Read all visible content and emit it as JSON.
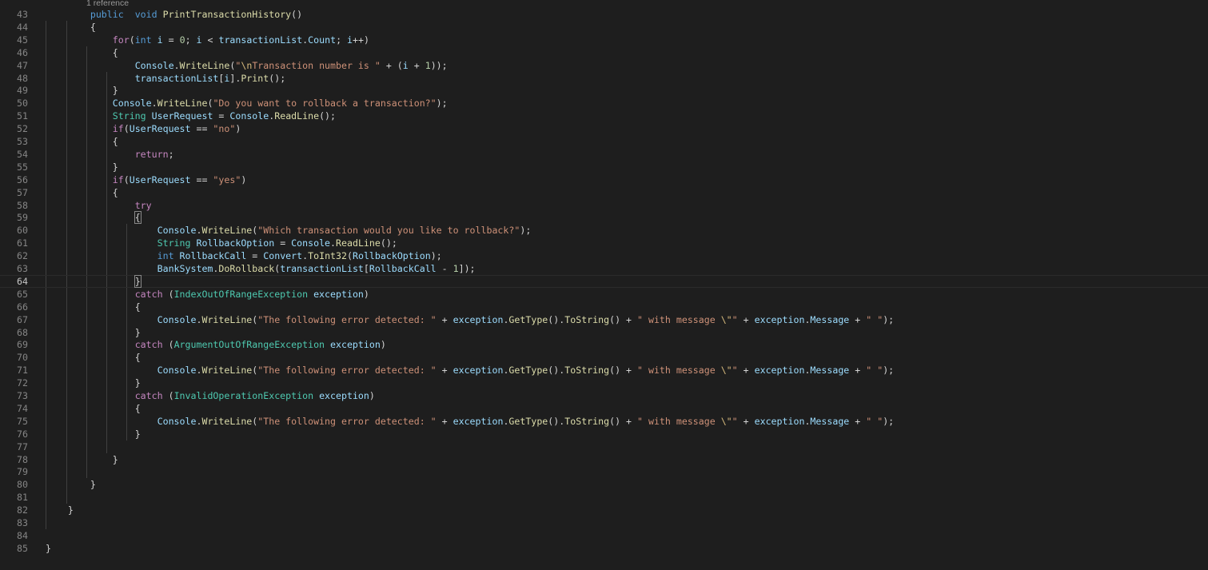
{
  "codelens": "1 reference",
  "lines": [
    {
      "n": "43",
      "indent": "        ",
      "tokens": [
        [
          "kw",
          "public"
        ],
        [
          "",
          "  "
        ],
        [
          "kw",
          "void"
        ],
        [
          "",
          " "
        ],
        [
          "fn",
          "PrintTransactionHistory"
        ],
        [
          "",
          "()"
        ]
      ]
    },
    {
      "n": "44",
      "indent": "        ",
      "tokens": [
        [
          "",
          "{"
        ]
      ]
    },
    {
      "n": "45",
      "indent": "            ",
      "tokens": [
        [
          "ctl",
          "for"
        ],
        [
          "",
          "("
        ],
        [
          "kw",
          "int"
        ],
        [
          "",
          " "
        ],
        [
          "var",
          "i"
        ],
        [
          "",
          " = "
        ],
        [
          "num",
          "0"
        ],
        [
          "",
          "; "
        ],
        [
          "var",
          "i"
        ],
        [
          "",
          " < "
        ],
        [
          "var",
          "transactionList"
        ],
        [
          "",
          "."
        ],
        [
          "var",
          "Count"
        ],
        [
          "",
          "; "
        ],
        [
          "var",
          "i"
        ],
        [
          "",
          "++)"
        ]
      ]
    },
    {
      "n": "46",
      "indent": "            ",
      "tokens": [
        [
          "",
          "{"
        ]
      ]
    },
    {
      "n": "47",
      "indent": "                ",
      "tokens": [
        [
          "var",
          "Console"
        ],
        [
          "",
          "."
        ],
        [
          "fn",
          "WriteLine"
        ],
        [
          "",
          "("
        ],
        [
          "str",
          "\""
        ],
        [
          "esc",
          "\\n"
        ],
        [
          "str",
          "Transaction number is \""
        ],
        [
          "",
          " + ("
        ],
        [
          "var",
          "i"
        ],
        [
          "",
          " + "
        ],
        [
          "num",
          "1"
        ],
        [
          "",
          "));"
        ]
      ]
    },
    {
      "n": "48",
      "indent": "                ",
      "tokens": [
        [
          "var",
          "transactionList"
        ],
        [
          "",
          "["
        ],
        [
          "var",
          "i"
        ],
        [
          "",
          "]."
        ],
        [
          "fn",
          "Print"
        ],
        [
          "",
          "();"
        ]
      ]
    },
    {
      "n": "49",
      "indent": "            ",
      "tokens": [
        [
          "",
          "}"
        ]
      ]
    },
    {
      "n": "50",
      "indent": "            ",
      "tokens": [
        [
          "var",
          "Console"
        ],
        [
          "",
          "."
        ],
        [
          "fn",
          "WriteLine"
        ],
        [
          "",
          "("
        ],
        [
          "str",
          "\"Do you want to rollback a transaction?\""
        ],
        [
          "",
          ");"
        ]
      ]
    },
    {
      "n": "51",
      "indent": "            ",
      "tokens": [
        [
          "ty",
          "String"
        ],
        [
          "",
          " "
        ],
        [
          "var",
          "UserRequest"
        ],
        [
          "",
          " = "
        ],
        [
          "var",
          "Console"
        ],
        [
          "",
          "."
        ],
        [
          "fn",
          "ReadLine"
        ],
        [
          "",
          "();"
        ]
      ]
    },
    {
      "n": "52",
      "indent": "            ",
      "tokens": [
        [
          "ctl",
          "if"
        ],
        [
          "",
          "("
        ],
        [
          "var",
          "UserRequest"
        ],
        [
          "",
          " == "
        ],
        [
          "str",
          "\"no\""
        ],
        [
          "",
          ")"
        ]
      ]
    },
    {
      "n": "53",
      "indent": "            ",
      "tokens": [
        [
          "",
          "{"
        ]
      ]
    },
    {
      "n": "54",
      "indent": "                ",
      "tokens": [
        [
          "ctl",
          "return"
        ],
        [
          "",
          ";"
        ]
      ]
    },
    {
      "n": "55",
      "indent": "            ",
      "tokens": [
        [
          "",
          "}"
        ]
      ]
    },
    {
      "n": "56",
      "indent": "            ",
      "tokens": [
        [
          "ctl",
          "if"
        ],
        [
          "",
          "("
        ],
        [
          "var",
          "UserRequest"
        ],
        [
          "",
          " == "
        ],
        [
          "str",
          "\"yes\""
        ],
        [
          "",
          ")"
        ]
      ]
    },
    {
      "n": "57",
      "indent": "            ",
      "tokens": [
        [
          "",
          "{"
        ]
      ]
    },
    {
      "n": "58",
      "indent": "                ",
      "tokens": [
        [
          "ctl",
          "try"
        ]
      ]
    },
    {
      "n": "59",
      "indent": "                ",
      "tokens": [
        [
          "brhl",
          "{"
        ]
      ]
    },
    {
      "n": "60",
      "indent": "                    ",
      "tokens": [
        [
          "var",
          "Console"
        ],
        [
          "",
          "."
        ],
        [
          "fn",
          "WriteLine"
        ],
        [
          "",
          "("
        ],
        [
          "str",
          "\"Which transaction would you like to rollback?\""
        ],
        [
          "",
          ");"
        ]
      ]
    },
    {
      "n": "61",
      "indent": "                    ",
      "tokens": [
        [
          "ty",
          "String"
        ],
        [
          "",
          " "
        ],
        [
          "var",
          "RollbackOption"
        ],
        [
          "",
          " = "
        ],
        [
          "var",
          "Console"
        ],
        [
          "",
          "."
        ],
        [
          "fn",
          "ReadLine"
        ],
        [
          "",
          "();"
        ]
      ]
    },
    {
      "n": "62",
      "indent": "                    ",
      "tokens": [
        [
          "kw",
          "int"
        ],
        [
          "",
          " "
        ],
        [
          "var",
          "RollbackCall"
        ],
        [
          "",
          " = "
        ],
        [
          "var",
          "Convert"
        ],
        [
          "",
          "."
        ],
        [
          "fn",
          "ToInt32"
        ],
        [
          "",
          "("
        ],
        [
          "var",
          "RollbackOption"
        ],
        [
          "",
          ");"
        ]
      ]
    },
    {
      "n": "63",
      "indent": "                    ",
      "tokens": [
        [
          "var",
          "BankSystem"
        ],
        [
          "",
          "."
        ],
        [
          "fn",
          "DoRollback"
        ],
        [
          "",
          "("
        ],
        [
          "var",
          "transactionList"
        ],
        [
          "",
          "["
        ],
        [
          "var",
          "RollbackCall"
        ],
        [
          "",
          " - "
        ],
        [
          "num",
          "1"
        ],
        [
          "",
          "]);"
        ]
      ]
    },
    {
      "n": "64",
      "indent": "                ",
      "tokens": [
        [
          "brhl",
          "}"
        ]
      ],
      "current": true
    },
    {
      "n": "65",
      "indent": "                ",
      "tokens": [
        [
          "ctl",
          "catch"
        ],
        [
          "",
          " ("
        ],
        [
          "ty",
          "IndexOutOfRangeException"
        ],
        [
          "",
          " "
        ],
        [
          "var",
          "exception"
        ],
        [
          "",
          ")"
        ]
      ]
    },
    {
      "n": "66",
      "indent": "                ",
      "tokens": [
        [
          "",
          "{"
        ]
      ]
    },
    {
      "n": "67",
      "indent": "                    ",
      "tokens": [
        [
          "var",
          "Console"
        ],
        [
          "",
          "."
        ],
        [
          "fn",
          "WriteLine"
        ],
        [
          "",
          "("
        ],
        [
          "str",
          "\"The following error detected: \""
        ],
        [
          "",
          " + "
        ],
        [
          "var",
          "exception"
        ],
        [
          "",
          "."
        ],
        [
          "fn",
          "GetType"
        ],
        [
          "",
          "()."
        ],
        [
          "fn",
          "ToString"
        ],
        [
          "",
          "() + "
        ],
        [
          "str",
          "\" with message "
        ],
        [
          "esc",
          "\\\""
        ],
        [
          "str",
          "\""
        ],
        [
          "",
          " + "
        ],
        [
          "var",
          "exception"
        ],
        [
          "",
          "."
        ],
        [
          "var",
          "Message"
        ],
        [
          "",
          " + "
        ],
        [
          "str",
          "\" \""
        ],
        [
          "",
          ");"
        ]
      ]
    },
    {
      "n": "68",
      "indent": "                ",
      "tokens": [
        [
          "",
          "}"
        ]
      ]
    },
    {
      "n": "69",
      "indent": "                ",
      "tokens": [
        [
          "ctl",
          "catch"
        ],
        [
          "",
          " ("
        ],
        [
          "ty",
          "ArgumentOutOfRangeException"
        ],
        [
          "",
          " "
        ],
        [
          "var",
          "exception"
        ],
        [
          "",
          ")"
        ]
      ]
    },
    {
      "n": "70",
      "indent": "                ",
      "tokens": [
        [
          "",
          "{"
        ]
      ]
    },
    {
      "n": "71",
      "indent": "                    ",
      "tokens": [
        [
          "var",
          "Console"
        ],
        [
          "",
          "."
        ],
        [
          "fn",
          "WriteLine"
        ],
        [
          "",
          "("
        ],
        [
          "str",
          "\"The following error detected: \""
        ],
        [
          "",
          " + "
        ],
        [
          "var",
          "exception"
        ],
        [
          "",
          "."
        ],
        [
          "fn",
          "GetType"
        ],
        [
          "",
          "()."
        ],
        [
          "fn",
          "ToString"
        ],
        [
          "",
          "() + "
        ],
        [
          "str",
          "\" with message "
        ],
        [
          "esc",
          "\\\""
        ],
        [
          "str",
          "\""
        ],
        [
          "",
          " + "
        ],
        [
          "var",
          "exception"
        ],
        [
          "",
          "."
        ],
        [
          "var",
          "Message"
        ],
        [
          "",
          " + "
        ],
        [
          "str",
          "\" \""
        ],
        [
          "",
          ");"
        ]
      ]
    },
    {
      "n": "72",
      "indent": "                ",
      "tokens": [
        [
          "",
          "}"
        ]
      ]
    },
    {
      "n": "73",
      "indent": "                ",
      "tokens": [
        [
          "ctl",
          "catch"
        ],
        [
          "",
          " ("
        ],
        [
          "ty",
          "InvalidOperationException"
        ],
        [
          "",
          " "
        ],
        [
          "var",
          "exception"
        ],
        [
          "",
          ")"
        ]
      ]
    },
    {
      "n": "74",
      "indent": "                ",
      "tokens": [
        [
          "",
          "{"
        ]
      ]
    },
    {
      "n": "75",
      "indent": "                    ",
      "tokens": [
        [
          "var",
          "Console"
        ],
        [
          "",
          "."
        ],
        [
          "fn",
          "WriteLine"
        ],
        [
          "",
          "("
        ],
        [
          "str",
          "\"The following error detected: \""
        ],
        [
          "",
          " + "
        ],
        [
          "var",
          "exception"
        ],
        [
          "",
          "."
        ],
        [
          "fn",
          "GetType"
        ],
        [
          "",
          "()."
        ],
        [
          "fn",
          "ToString"
        ],
        [
          "",
          "() + "
        ],
        [
          "str",
          "\" with message "
        ],
        [
          "esc",
          "\\\""
        ],
        [
          "str",
          "\""
        ],
        [
          "",
          " + "
        ],
        [
          "var",
          "exception"
        ],
        [
          "",
          "."
        ],
        [
          "var",
          "Message"
        ],
        [
          "",
          " + "
        ],
        [
          "str",
          "\" \""
        ],
        [
          "",
          ");"
        ]
      ]
    },
    {
      "n": "76",
      "indent": "                ",
      "tokens": [
        [
          "",
          "}"
        ]
      ]
    },
    {
      "n": "77",
      "indent": "",
      "tokens": []
    },
    {
      "n": "78",
      "indent": "            ",
      "tokens": [
        [
          "",
          "}"
        ]
      ]
    },
    {
      "n": "79",
      "indent": "",
      "tokens": []
    },
    {
      "n": "80",
      "indent": "        ",
      "tokens": [
        [
          "",
          "}"
        ]
      ]
    },
    {
      "n": "81",
      "indent": "",
      "tokens": []
    },
    {
      "n": "82",
      "indent": "    ",
      "tokens": [
        [
          "",
          "}"
        ]
      ]
    },
    {
      "n": "83",
      "indent": "",
      "tokens": []
    },
    {
      "n": "84",
      "indent": "",
      "tokens": []
    },
    {
      "n": "85",
      "indent": "",
      "tokens": [
        [
          "",
          "}"
        ]
      ]
    }
  ],
  "colors": {
    "background": "#1e1e1e",
    "line_number": "#858585",
    "keyword": "#569cd6",
    "control": "#c586c0",
    "type": "#4ec9b0",
    "function": "#dcdcaa",
    "string": "#ce9178",
    "variable": "#9cdcfe",
    "number": "#b5cea8"
  }
}
